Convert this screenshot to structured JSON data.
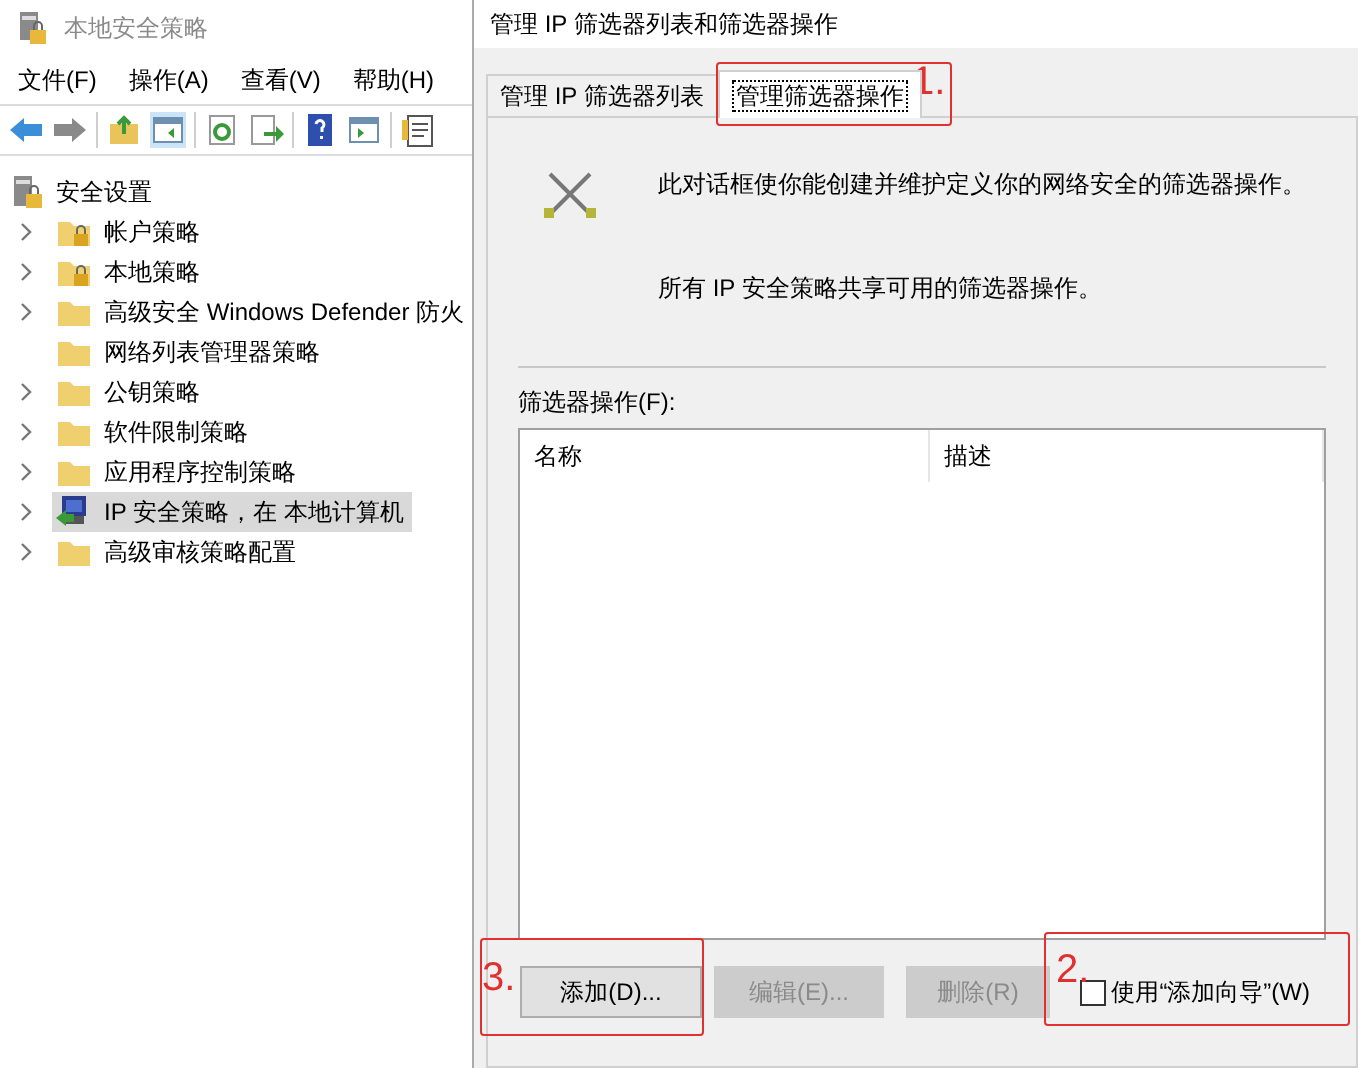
{
  "main_window": {
    "title": "本地安全策略",
    "menu": [
      "文件(F)",
      "操作(A)",
      "查看(V)",
      "帮助(H)"
    ],
    "tree": {
      "label": "安全设置",
      "kind": "root",
      "children": [
        {
          "label": "帐户策略",
          "kind": "locked-folder",
          "expandable": true,
          "selected": false
        },
        {
          "label": "本地策略",
          "kind": "locked-folder",
          "expandable": true,
          "selected": false
        },
        {
          "label": "高级安全 Windows Defender 防火",
          "kind": "folder",
          "expandable": true,
          "selected": false
        },
        {
          "label": "网络列表管理器策略",
          "kind": "folder",
          "expandable": false,
          "selected": false
        },
        {
          "label": "公钥策略",
          "kind": "folder",
          "expandable": true,
          "selected": false
        },
        {
          "label": "软件限制策略",
          "kind": "folder",
          "expandable": true,
          "selected": false
        },
        {
          "label": "应用程序控制策略",
          "kind": "folder",
          "expandable": true,
          "selected": false
        },
        {
          "label": "IP 安全策略，在 本地计算机",
          "kind": "ip-policy",
          "expandable": true,
          "selected": true
        },
        {
          "label": "高级审核策略配置",
          "kind": "folder",
          "expandable": true,
          "selected": false
        }
      ]
    }
  },
  "dialog": {
    "title": "管理 IP 筛选器列表和筛选器操作",
    "tabs": [
      {
        "label": "管理 IP 筛选器列表",
        "selected": false
      },
      {
        "label": "管理筛选器操作",
        "selected": true
      }
    ],
    "description": "此对话框使你能创建并维护定义你的网络安全的筛选器操作。",
    "note": "所有 IP 安全策略共享可用的筛选器操作。",
    "list_label": "筛选器操作(F):",
    "columns": [
      "名称",
      "描述"
    ],
    "buttons": [
      {
        "label": "添加(D)...",
        "disabled": false
      },
      {
        "label": "编辑(E)...",
        "disabled": true
      },
      {
        "label": "删除(R)",
        "disabled": true
      }
    ],
    "wizard_checkbox": {
      "label": "使用“添加向导”(W)",
      "checked": false
    }
  },
  "annotations": [
    {
      "text": "1."
    },
    {
      "text": "2."
    },
    {
      "text": "3."
    }
  ]
}
